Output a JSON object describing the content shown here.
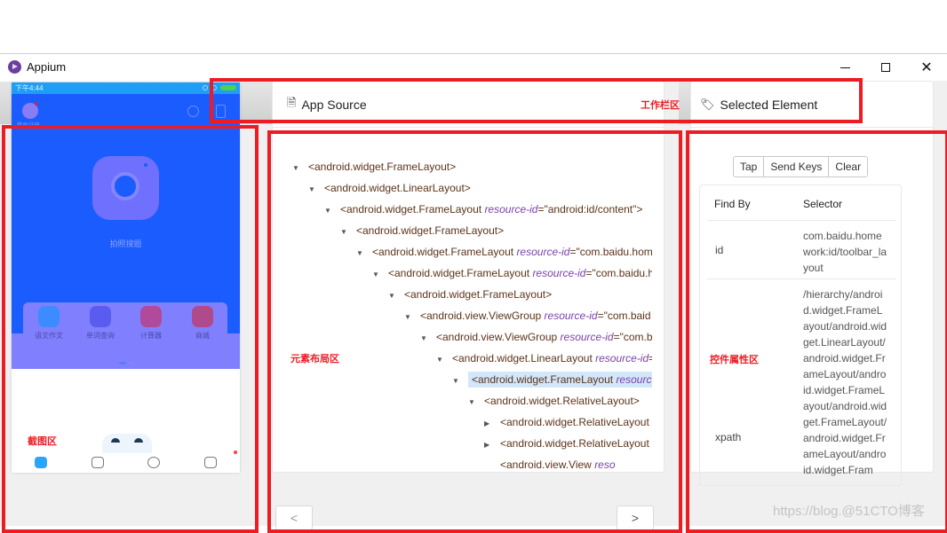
{
  "window": {
    "title": "Appium",
    "controls": {
      "minimize": "minimize",
      "maximize": "maximize",
      "close": "close"
    }
  },
  "toolbar": {
    "group_a": [
      {
        "name": "select-elements-button",
        "icon": "select-icon",
        "glyph": "⬚",
        "active": true
      },
      {
        "name": "swipe-button",
        "icon": "swipe-arrow-icon",
        "glyph": "→",
        "active": false
      },
      {
        "name": "tap-by-coordinates-button",
        "icon": "crop-frame-icon",
        "glyph": "⌗",
        "active": false
      }
    ],
    "group_b": [
      {
        "name": "back-button",
        "icon": "arrow-left-icon",
        "glyph": "←"
      },
      {
        "name": "refresh-button",
        "icon": "refresh-icon",
        "glyph": "↻"
      },
      {
        "name": "toggle-visibility-button",
        "icon": "eye-icon",
        "glyph": "◉"
      },
      {
        "name": "search-elements-button",
        "icon": "search-icon",
        "glyph": "○"
      },
      {
        "name": "copy-xml-button",
        "icon": "document-icon",
        "glyph": "▤"
      },
      {
        "name": "quit-session-button",
        "icon": "close-icon",
        "glyph": "✕"
      }
    ]
  },
  "annotations": {
    "toolbar": "工作栏区",
    "screenshot": "截图区",
    "source": "元素布局区",
    "attributes": "控件属性区"
  },
  "device": {
    "status_time": "下午4:44",
    "login_text": "登录/注册",
    "hero_caption": "拍照搜题",
    "quick_items": [
      {
        "label": "语文作文",
        "color": "#3d8cff"
      },
      {
        "label": "单词查询",
        "color": "#5a5cf0"
      },
      {
        "label": "计算器",
        "color": "#b04a9a"
      },
      {
        "label": "商城",
        "color": "#b04a8a"
      }
    ]
  },
  "source": {
    "title": "App Source",
    "nodes": [
      {
        "depth": 0,
        "toggle": "▼",
        "tag": "<android.widget.FrameLayout>",
        "attr": "",
        "val": ""
      },
      {
        "depth": 1,
        "toggle": "▼",
        "tag": "<android.widget.LinearLayout>",
        "attr": "",
        "val": ""
      },
      {
        "depth": 2,
        "toggle": "▼",
        "tag": "<android.widget.FrameLayout ",
        "attr": "resource-id",
        "val": "=\"android:id/content\">"
      },
      {
        "depth": 3,
        "toggle": "▼",
        "tag": "<android.widget.FrameLayout>",
        "attr": "",
        "val": ""
      },
      {
        "depth": 4,
        "toggle": "▼",
        "tag": "<android.widget.FrameLayout ",
        "attr": "resource-id",
        "val": "=\"com.baidu.hom"
      },
      {
        "depth": 5,
        "toggle": "▼",
        "tag": "<android.widget.FrameLayout ",
        "attr": "resource-id",
        "val": "=\"com.baidu.h"
      },
      {
        "depth": 6,
        "toggle": "▼",
        "tag": "<android.widget.FrameLayout>",
        "attr": "",
        "val": ""
      },
      {
        "depth": 7,
        "toggle": "▼",
        "tag": "<android.view.ViewGroup ",
        "attr": "resource-id",
        "val": "=\"com.baid"
      },
      {
        "depth": 8,
        "toggle": "▼",
        "tag": "<android.view.ViewGroup ",
        "attr": "resource-id",
        "val": "=\"com.b"
      },
      {
        "depth": 9,
        "toggle": "▼",
        "tag": "<android.widget.LinearLayout ",
        "attr": "resource-id",
        "val": "="
      },
      {
        "depth": 10,
        "toggle": "▼",
        "tag": "<android.widget.FrameLayout ",
        "attr": "resource",
        "val": "",
        "selected": true
      },
      {
        "depth": 11,
        "toggle": "▼",
        "tag": "<android.widget.RelativeLayout>",
        "attr": "",
        "val": ""
      },
      {
        "depth": 12,
        "toggle": "▶",
        "tag": "<android.widget.RelativeLayout",
        "attr": "",
        "val": ""
      },
      {
        "depth": 12,
        "toggle": "▶",
        "tag": "<android.widget.RelativeLayout",
        "attr": "",
        "val": ""
      },
      {
        "depth": 12,
        "toggle": "",
        "tag": "<android.view.View ",
        "attr": "reso",
        "val": ""
      }
    ],
    "pager_prev": "<",
    "pager_next": ">"
  },
  "selected_element": {
    "title": "Selected Element",
    "actions": [
      "Tap",
      "Send Keys",
      "Clear"
    ],
    "columns": [
      "Find By",
      "Selector"
    ],
    "rows": [
      {
        "find_by": "id",
        "selector": "com.baidu.homework:id/toolbar_layout"
      },
      {
        "find_by": "xpath",
        "selector": "/hierarchy/android.widget.FrameLayout/android.widget.LinearLayout/android.widget.FrameLayout/android.widget.FrameLayout/android.widget.FrameLayout/android.widget.FrameLayout/android.widget.Fram"
      }
    ]
  },
  "watermark": "https://blog.@51CTO博客"
}
